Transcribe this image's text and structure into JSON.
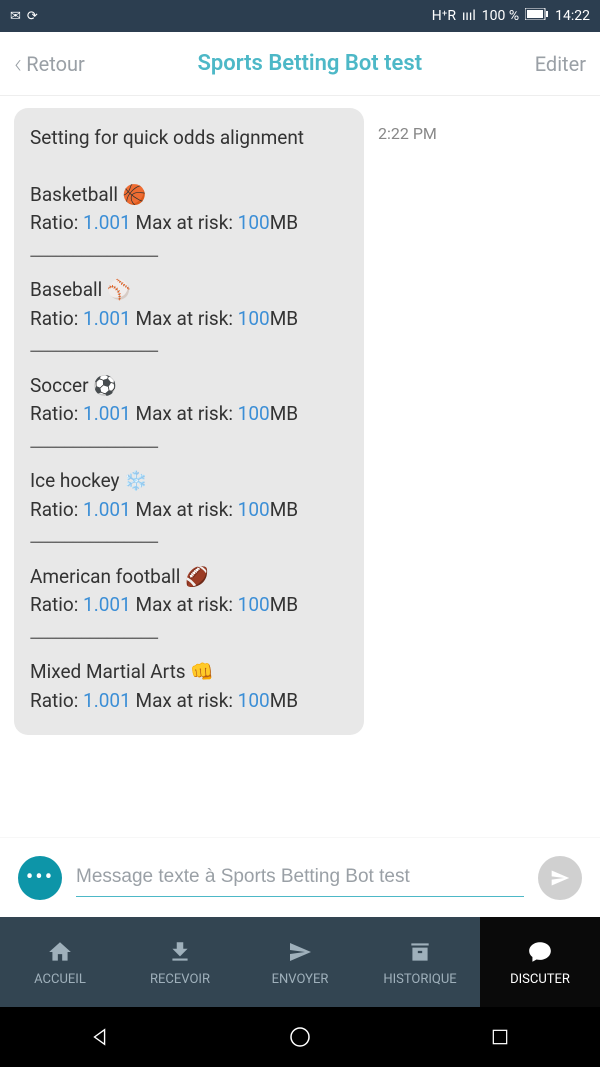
{
  "status": {
    "network": "H⁺R",
    "signal": "ıııl",
    "battery_pct": "100 %",
    "time": "14:22"
  },
  "header": {
    "back_label": "Retour",
    "title": "Sports Betting Bot test",
    "edit_label": "Editer"
  },
  "message": {
    "title": "Setting for quick odds alignment",
    "timestamp": "2:22 PM",
    "sports": [
      {
        "name": "Basketball 🏀",
        "ratio_label": "Ratio:",
        "ratio": "1.001",
        "max_label": "Max at risk:",
        "max": "100",
        "unit": "MB"
      },
      {
        "name": "Baseball ⚾",
        "ratio_label": "Ratio:",
        "ratio": "1.001",
        "max_label": "Max at risk:",
        "max": "100",
        "unit": "MB"
      },
      {
        "name": "Soccer ⚽",
        "ratio_label": "Ratio:",
        "ratio": "1.001",
        "max_label": "Max at risk:",
        "max": "100",
        "unit": "MB"
      },
      {
        "name": "Ice hockey ❄️",
        "ratio_label": "Ratio:",
        "ratio": "1.001",
        "max_label": "Max at risk:",
        "max": "100",
        "unit": "MB"
      },
      {
        "name": "American football 🏈",
        "ratio_label": "Ratio:",
        "ratio": "1.001",
        "max_label": "Max at risk:",
        "max": "100",
        "unit": "MB"
      },
      {
        "name": "Mixed Martial Arts 👊",
        "ratio_label": "Ratio:",
        "ratio": "1.001",
        "max_label": "Max at risk:",
        "max": "100",
        "unit": "MB"
      }
    ],
    "divider": "------------------------------"
  },
  "compose": {
    "placeholder": "Message texte à Sports Betting Bot test",
    "more_dots": "•••"
  },
  "tabs": {
    "home": "ACCUEIL",
    "receive": "RECEVOIR",
    "send": "ENVOYER",
    "history": "HISTORIQUE",
    "chat": "DISCUTER"
  }
}
